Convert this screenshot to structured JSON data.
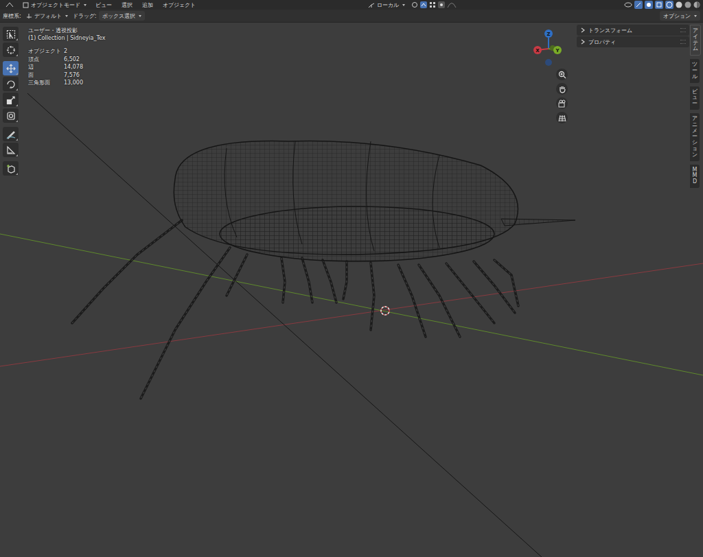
{
  "header": {
    "mode": "オブジェクトモード",
    "menus": [
      "ビュー",
      "選択",
      "追加",
      "オブジェクト"
    ],
    "orientation": "ローカル"
  },
  "tool_settings": {
    "coord_label": "座標系:",
    "coord_value": "デフォルト",
    "drag_label": "ドラッグ:",
    "drag_value": "ボックス選択",
    "options": "オプション"
  },
  "toolbar": [
    [
      {
        "kind": "select",
        "selected": false
      },
      {
        "kind": "cursor",
        "selected": false
      }
    ],
    [
      {
        "kind": "move",
        "selected": true
      },
      {
        "kind": "rotate",
        "selected": false
      },
      {
        "kind": "scale",
        "selected": false
      },
      {
        "kind": "transform",
        "selected": false
      }
    ],
    [
      {
        "kind": "annotate",
        "selected": false
      },
      {
        "kind": "measure",
        "selected": false
      }
    ],
    [
      {
        "kind": "addcube",
        "selected": false
      }
    ]
  ],
  "overlay": {
    "view": "ユーザー・透視投影",
    "collection": "(1) Collection | Sidneyia_Tex",
    "stats": [
      {
        "label": "オブジェクト",
        "value": "2"
      },
      {
        "label": "頂点",
        "value": "6,502"
      },
      {
        "label": "辺",
        "value": "14,078"
      },
      {
        "label": "面",
        "value": "7,576"
      },
      {
        "label": "三角形面",
        "value": "13,000"
      }
    ]
  },
  "gizmo": {
    "z": "Z",
    "x": "X",
    "y": "Y"
  },
  "sidebar": {
    "panels": [
      {
        "title": "トランスフォーム",
        "expanded": false
      },
      {
        "title": "プロパティ",
        "expanded": false
      }
    ],
    "tabs": [
      {
        "label": "アイテム",
        "selected": true
      },
      {
        "label": "ツール",
        "selected": false
      },
      {
        "label": "ビュー",
        "selected": false
      },
      {
        "label": "アニメーション",
        "selected": false
      },
      {
        "label": "MMD",
        "selected": false
      }
    ]
  }
}
